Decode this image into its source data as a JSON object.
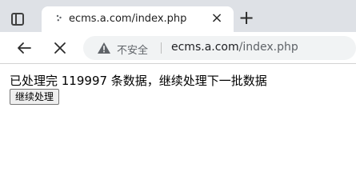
{
  "browser": {
    "tab": {
      "title": "ecms.a.com/index.php",
      "close_symbol": "×"
    },
    "new_tab_symbol": "+",
    "address_bar": {
      "security_label": "不安全",
      "url_host": "ecms.a.com",
      "url_path": "/index.php"
    },
    "icons": {
      "tab_actions": "tab-actions-icon",
      "loading": "loading-spinner-icon",
      "back": "back-arrow-icon",
      "stop": "close-icon",
      "warning": "warning-triangle-icon"
    }
  },
  "page": {
    "message": "已处理完 119997 条数据，继续处理下一批数据",
    "continue_button_label": "继续处理"
  }
}
